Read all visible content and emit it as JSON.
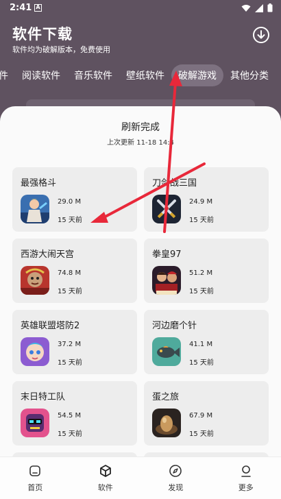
{
  "status": {
    "time": "2:41"
  },
  "header": {
    "title": "软件下载",
    "subtitle": "软件均为破解版本，免费使用"
  },
  "tabs": [
    {
      "label": "件"
    },
    {
      "label": "阅读软件"
    },
    {
      "label": "音乐软件"
    },
    {
      "label": "壁纸软件"
    },
    {
      "label": "破解游戏",
      "active": true
    },
    {
      "label": "其他分类"
    }
  ],
  "refresh": {
    "title": "刷新完成",
    "updated": "上次更新 11-18 14:4"
  },
  "apps": [
    {
      "name": "最强格斗",
      "size": "29.0 M",
      "age": "15 天前",
      "icon": "fighter-game-icon"
    },
    {
      "name": "刀剑战三国",
      "size": "24.9 M",
      "age": "15 天前",
      "icon": "crossed-swords-game-icon"
    },
    {
      "name": "西游大闹天宫",
      "size": "74.8 M",
      "age": "15 天前",
      "icon": "monkey-king-game-icon"
    },
    {
      "name": "拳皇97",
      "size": "51.2 M",
      "age": "15 天前",
      "icon": "kof97-game-icon"
    },
    {
      "name": "英雄联盟塔防2",
      "size": "37.2 M",
      "age": "15 天前",
      "icon": "tower-defense-game-icon"
    },
    {
      "name": "河边磨个针",
      "size": "41.1 M",
      "age": "15 天前",
      "icon": "fish-game-icon"
    },
    {
      "name": "末日特工队",
      "size": "54.5 M",
      "age": "15 天前",
      "icon": "agent-squad-game-icon"
    },
    {
      "name": "蛋之旅",
      "size": "67.9 M",
      "age": "15 天前",
      "icon": "egg-game-icon"
    }
  ],
  "nav": [
    {
      "label": "首页",
      "icon": "home-icon"
    },
    {
      "label": "软件",
      "icon": "cube-icon"
    },
    {
      "label": "发现",
      "icon": "compass-icon"
    },
    {
      "label": "更多",
      "icon": "person-icon"
    }
  ],
  "colors": {
    "header_bg": "#5f5260",
    "sheet_bg": "#fafafa",
    "card_bg": "#ededed",
    "annotation_arrow": "#e8283a"
  }
}
